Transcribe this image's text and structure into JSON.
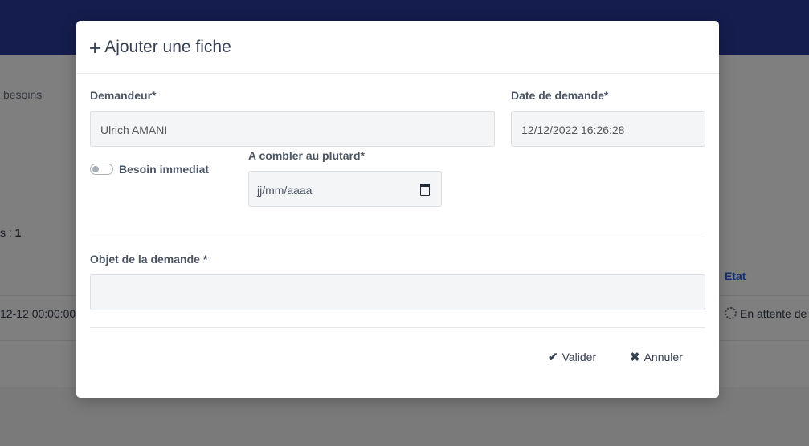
{
  "background": {
    "breadcrumb": "besoins",
    "count_prefix": "s : ",
    "count_value": "1",
    "column_etat": "Etat",
    "row_date": "12-12 00:00:00",
    "row_status": "En attente de"
  },
  "modal": {
    "title": "Ajouter une fiche",
    "demandeur_label": "Demandeur*",
    "demandeur_value": "Ulrich AMANI",
    "date_label": "Date de demande*",
    "date_value": "12/12/2022 16:26:28",
    "toggle_label": "Besoin immediat",
    "toggle_on": false,
    "combler_label": "A combler au plutard*",
    "combler_placeholder": "jj/mm/aaaa",
    "objet_label": "Objet de la demande *",
    "objet_value": "",
    "valider_label": "Valider",
    "annuler_label": "Annuler"
  },
  "colors": {
    "topbar": "#2b3a9c",
    "link": "#2563eb"
  }
}
